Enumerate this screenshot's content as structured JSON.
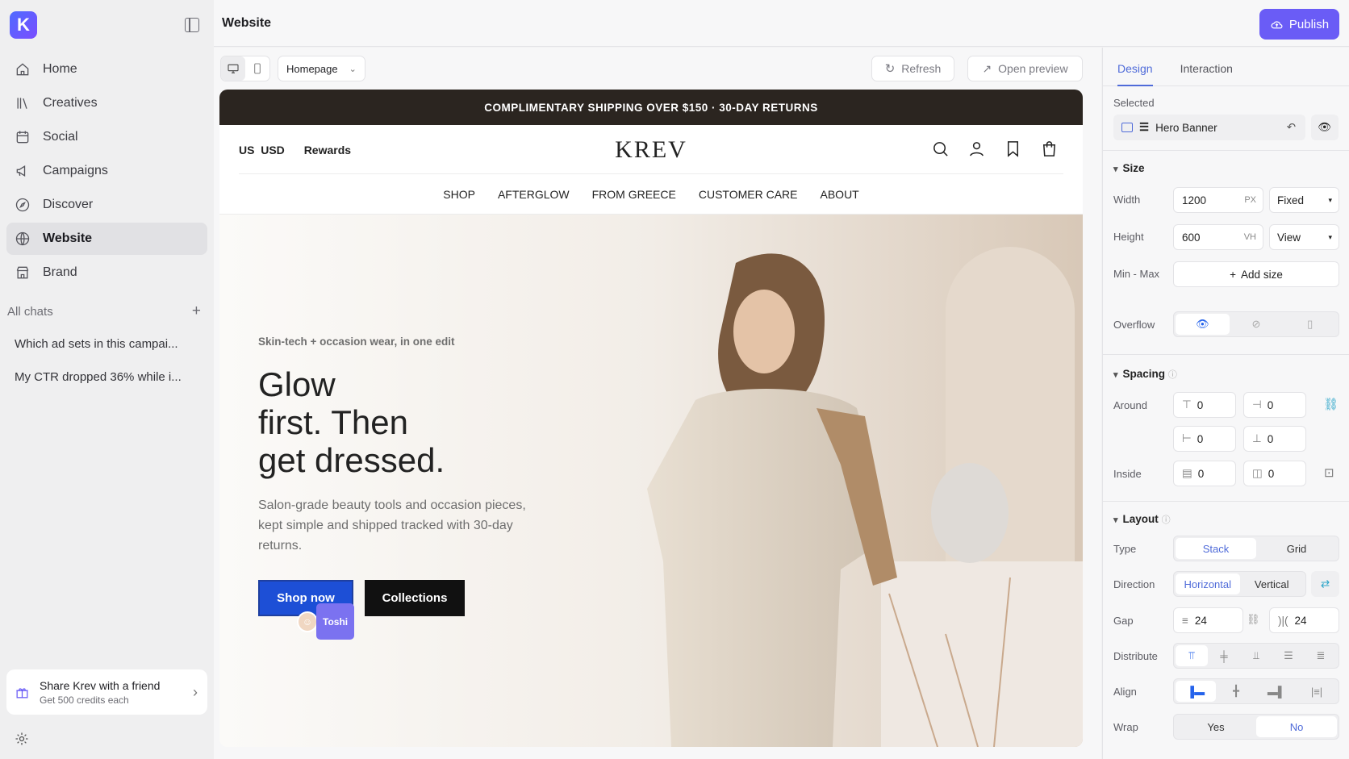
{
  "app": {
    "logo_letter": "K",
    "accent": "#6a5cf6"
  },
  "sidebar": {
    "items": [
      {
        "label": "Home"
      },
      {
        "label": "Creatives"
      },
      {
        "label": "Social"
      },
      {
        "label": "Campaigns"
      },
      {
        "label": "Discover"
      },
      {
        "label": "Website"
      },
      {
        "label": "Brand"
      }
    ],
    "all_chats": "All chats",
    "chats": [
      "Which ad sets in this campai...",
      "My CTR dropped 36% while i..."
    ],
    "share_title": "Share Krev with a friend",
    "share_sub": "Get 500 credits each"
  },
  "topbar": {
    "title": "Website",
    "publish": "Publish"
  },
  "editor": {
    "page": "Homepage",
    "refresh": "Refresh",
    "open_preview": "Open preview"
  },
  "site": {
    "announcement": "COMPLIMENTARY SHIPPING OVER $150 · 30-DAY RETURNS",
    "region": "US  USD",
    "rewards": "Rewards",
    "brand": "KREV",
    "menu": [
      "SHOP",
      "AFTERGLOW",
      "FROM GREECE",
      "CUSTOMER CARE",
      "ABOUT"
    ],
    "kicker": "Skin-tech + occasion wear, in one edit",
    "headline_1": "Glow",
    "headline_2": "first. Then",
    "headline_3": "get dressed.",
    "subcopy": "Salon-grade beauty tools and occasion pieces, kept simple and shipped tracked with 30-day returns.",
    "cta_primary": "Shop now",
    "cta_secondary": "Collections",
    "cursor_user": "Toshi"
  },
  "panel": {
    "tabs": [
      "Design",
      "Interaction"
    ],
    "selected_label": "Selected",
    "selected": "Hero Banner",
    "size_title": "Size",
    "width_label": "Width",
    "width": "1200",
    "width_unit": "PX",
    "width_mode": "Fixed",
    "height_label": "Height",
    "height": "600",
    "height_unit": "VH",
    "height_mode": "View",
    "minmax_label": "Min - Max",
    "add_size": "Add size",
    "overflow_label": "Overflow",
    "spacing_title": "Spacing",
    "around_label": "Around",
    "around": [
      "0",
      "0",
      "0",
      "0"
    ],
    "inside_label": "Inside",
    "inside": [
      "0",
      "0"
    ],
    "layout_title": "Layout",
    "type_label": "Type",
    "type_options": [
      "Stack",
      "Grid"
    ],
    "direction_label": "Direction",
    "direction_options": [
      "Horizontal",
      "Vertical"
    ],
    "gap_label": "Gap",
    "gap_x": "24",
    "gap_y": "24",
    "distribute_label": "Distribute",
    "align_label": "Align",
    "wrap_label": "Wrap",
    "wrap_options": [
      "Yes",
      "No"
    ]
  }
}
